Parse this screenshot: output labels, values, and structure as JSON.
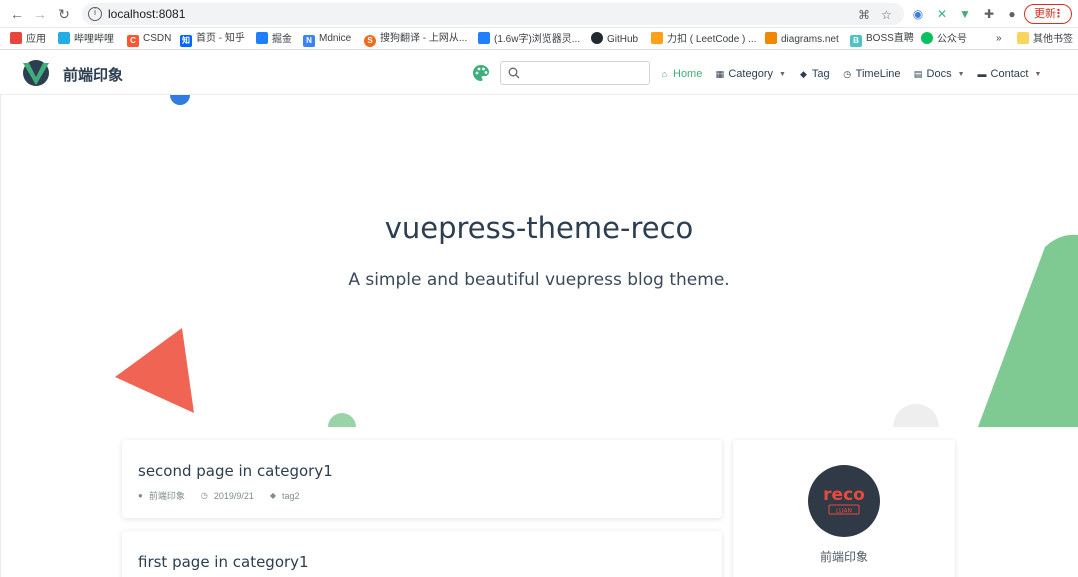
{
  "browser": {
    "url": "localhost:8081",
    "update_label": "更新",
    "more_bookmarks": "»",
    "bookmarks": [
      {
        "label": "应用",
        "icon": "apps-grid-icon",
        "color": "#e8453c"
      },
      {
        "label": "哔哩哔哩",
        "icon": "bilibili-icon",
        "color": "#23ade5"
      },
      {
        "label": "CSDN",
        "icon": "csdn-icon",
        "color": "#fc5531"
      },
      {
        "label": "首页 - 知乎",
        "icon": "zhihu-icon",
        "color": "#0066ff"
      },
      {
        "label": "掘金",
        "icon": "juejin-icon",
        "color": "#1e80ff"
      },
      {
        "label": "Mdnice",
        "icon": "mdnice-icon",
        "color": "#3b82f6"
      },
      {
        "label": "搜狗翻译 - 上网从...",
        "icon": "sogou-icon",
        "color": "#f26b1d"
      },
      {
        "label": "(1.6w字)浏览器灵...",
        "icon": "juejin-icon",
        "color": "#1e80ff"
      },
      {
        "label": "GitHub",
        "icon": "github-icon",
        "color": "#24292e"
      },
      {
        "label": "力扣 ( LeetCode ) ...",
        "icon": "leetcode-icon",
        "color": "#ffa116"
      },
      {
        "label": "diagrams.net",
        "icon": "diagrams-icon",
        "color": "#f08705"
      },
      {
        "label": "BOSS直聘",
        "icon": "boss-icon",
        "color": "#4fc3c3"
      },
      {
        "label": "公众号",
        "icon": "wechat-icon",
        "color": "#07c160"
      }
    ],
    "other_bookmarks": "其他书签"
  },
  "navbar": {
    "site_name": "前端印象",
    "links": [
      {
        "label": "Home",
        "icon": "home-icon",
        "active": true,
        "dropdown": false
      },
      {
        "label": "Category",
        "icon": "category-grid-icon",
        "active": false,
        "dropdown": true
      },
      {
        "label": "Tag",
        "icon": "tag-icon",
        "active": false,
        "dropdown": false
      },
      {
        "label": "TimeLine",
        "icon": "clock-icon",
        "active": false,
        "dropdown": false
      },
      {
        "label": "Docs",
        "icon": "docs-icon",
        "active": false,
        "dropdown": true
      },
      {
        "label": "Contact",
        "icon": "contact-icon",
        "active": false,
        "dropdown": true
      }
    ]
  },
  "hero": {
    "title": "vuepress-theme-reco",
    "description": "A simple and beautiful vuepress blog theme."
  },
  "posts": [
    {
      "title": "second page in category1",
      "author": "前端印象",
      "date": "2019/9/21",
      "tag": "tag2"
    },
    {
      "title": "first page in category1"
    }
  ],
  "profile": {
    "avatar_text": "reco",
    "avatar_badge": "LUAN",
    "name": "前端印象"
  },
  "colors": {
    "accent": "#3eaf7c",
    "triangle_red": "#f06453",
    "green_shape": "#7fc993"
  }
}
